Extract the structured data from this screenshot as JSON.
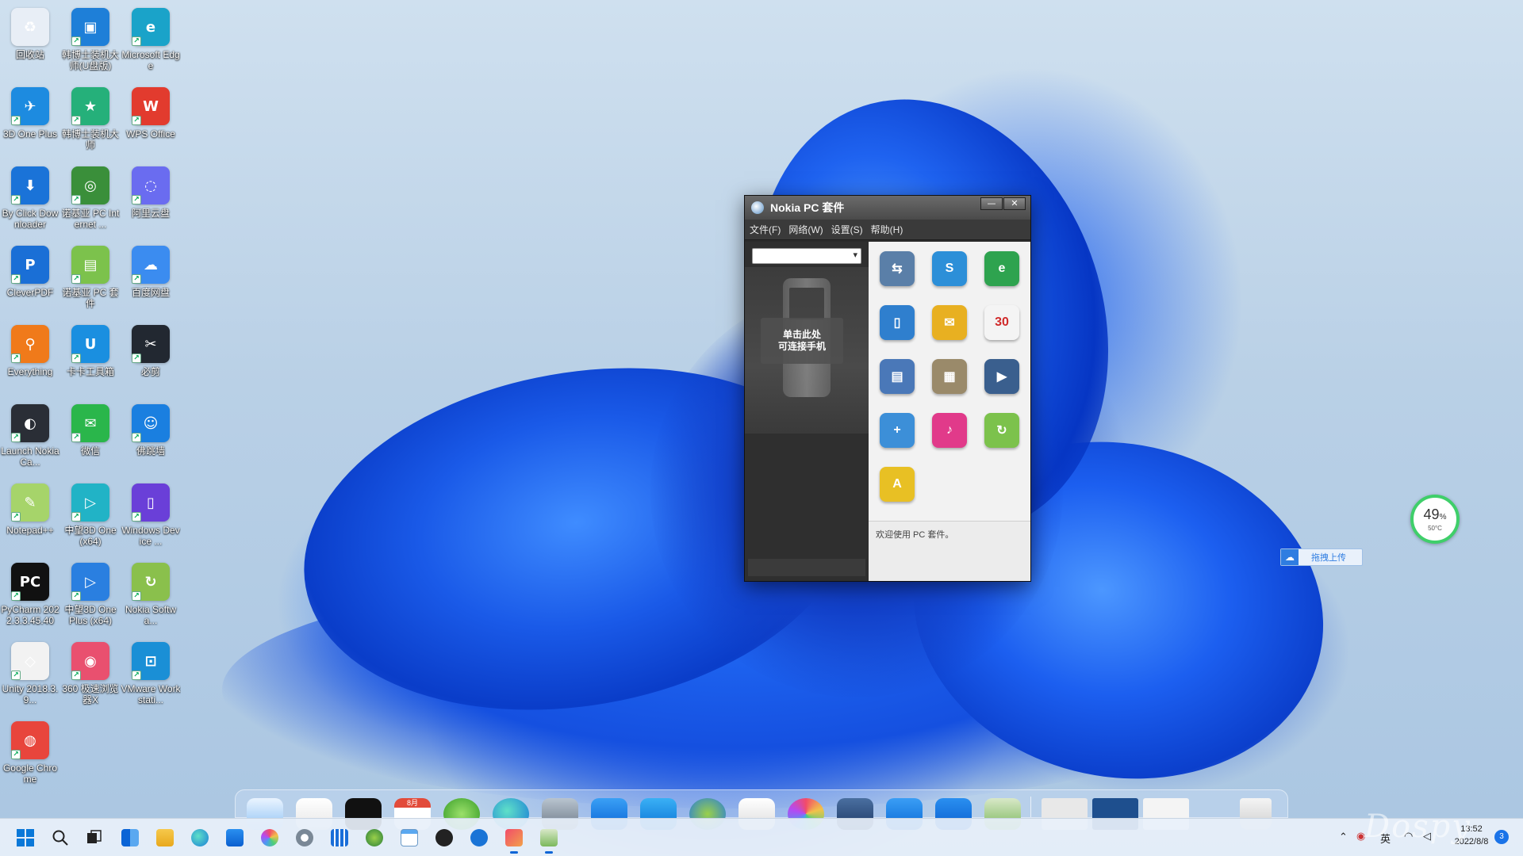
{
  "desktop": {
    "icons": [
      {
        "label": "回收站",
        "icon": "recycle-bin-icon",
        "color": "#e8eef6",
        "glyph": "♻"
      },
      {
        "label": "韩博士装机大师(U盘版)",
        "icon": "usb-installer-icon",
        "color": "#1e7fd8",
        "glyph": "▣"
      },
      {
        "label": "Microsoft Edge",
        "icon": "edge-icon",
        "color": "#1aa3c9",
        "glyph": "e"
      },
      {
        "label": "3D One Plus",
        "icon": "3d-one-plus-icon",
        "color": "#1d8be0",
        "glyph": "✈"
      },
      {
        "label": "韩博士装机大师",
        "icon": "installer-icon",
        "color": "#25b07a",
        "glyph": "★"
      },
      {
        "label": "WPS Office",
        "icon": "wps-office-icon",
        "color": "#e23b2e",
        "glyph": "W"
      },
      {
        "label": "By Click Downloader",
        "icon": "downloader-icon",
        "color": "#1a73d8",
        "glyph": "⬇"
      },
      {
        "label": "诺基亚 PC Internet ...",
        "icon": "globe-icon",
        "color": "#3a8f3a",
        "glyph": "◎"
      },
      {
        "label": "阿里云盘",
        "icon": "aliyun-drive-icon",
        "color": "#6a6cf0",
        "glyph": "◌"
      },
      {
        "label": "CleverPDF",
        "icon": "pdf-icon",
        "color": "#1a6fd6",
        "glyph": "P"
      },
      {
        "label": "诺基亚 PC 套件",
        "icon": "nokia-suite-icon",
        "color": "#7cc24c",
        "glyph": "▤"
      },
      {
        "label": "百度网盘",
        "icon": "baidu-netdisk-icon",
        "color": "#3b8cf0",
        "glyph": "☁"
      },
      {
        "label": "Everything",
        "icon": "search-magnifier-icon",
        "color": "#f07a1a",
        "glyph": "⚲"
      },
      {
        "label": "卡卡工具箱",
        "icon": "toolbox-icon",
        "color": "#1a8fe0",
        "glyph": "U"
      },
      {
        "label": "必剪",
        "icon": "bijian-icon",
        "color": "#222831",
        "glyph": "✂"
      },
      {
        "label": "Launch Nokia Ca...",
        "icon": "nokia-camera-icon",
        "color": "#2a2e36",
        "glyph": "◐"
      },
      {
        "label": "微信",
        "icon": "wechat-icon",
        "color": "#2ab64b",
        "glyph": "✉"
      },
      {
        "label": "佛跳墙",
        "icon": "foxiaoqiang-icon",
        "color": "#1a7fe0",
        "glyph": "☺"
      },
      {
        "label": "Notepad++",
        "icon": "notepad-plus-icon",
        "color": "#a6d46a",
        "glyph": "✎"
      },
      {
        "label": "中望3D One (x64)",
        "icon": "zw3d-one-icon",
        "color": "#21b3c6",
        "glyph": "▷"
      },
      {
        "label": "Windows Device ...",
        "icon": "windows-device-icon",
        "color": "#6a3fd8",
        "glyph": "▯"
      },
      {
        "label": "PyCharm 2022.3.3.45.40",
        "icon": "pycharm-icon",
        "color": "#111111",
        "glyph": "PC"
      },
      {
        "label": "中望3D One Plus (x64)",
        "icon": "zw3d-one-plus-icon",
        "color": "#2a7fe0",
        "glyph": "▷"
      },
      {
        "label": "Nokia Softwa...",
        "icon": "nokia-software-icon",
        "color": "#8ac04c",
        "glyph": "↻"
      },
      {
        "label": "Unity 2018.3.9...",
        "icon": "unity-icon",
        "color": "#f2f2f2",
        "glyph": "◇"
      },
      {
        "label": "360 极速浏览器X",
        "icon": "browser-360-icon",
        "color": "#e9506f",
        "glyph": "◉"
      },
      {
        "label": "VMware Workstati...",
        "icon": "vmware-icon",
        "color": "#1a8fd6",
        "glyph": "⊡"
      },
      {
        "label": "Google Chrome",
        "icon": "chrome-icon",
        "color": "#e8453c",
        "glyph": "◍"
      }
    ]
  },
  "nokia_window": {
    "title": "Nokia PC 套件",
    "minimize_label": "—",
    "close_label": "✕",
    "menu": [
      "文件(F)",
      "网络(W)",
      "设置(S)",
      "帮助(H)"
    ],
    "device_select_value": "",
    "connect_line1": "单击此处",
    "connect_line2": "可连接手机",
    "apps": [
      {
        "name": "backup-app-icon",
        "color": "#5a7fa8",
        "glyph": "⇆"
      },
      {
        "name": "sync-app-icon",
        "color": "#2c8fd8",
        "glyph": "S"
      },
      {
        "name": "connection-app-icon",
        "color": "#2ea34f",
        "glyph": "e"
      },
      {
        "name": "contacts-app-icon",
        "color": "#2f7fce",
        "glyph": "▯"
      },
      {
        "name": "messages-app-icon",
        "color": "#e8b021",
        "glyph": "✉"
      },
      {
        "name": "calendar-app-icon",
        "color": "#f4f4f4",
        "glyph": "30"
      },
      {
        "name": "file-manager-app-icon",
        "color": "#4a78b8",
        "glyph": "▤"
      },
      {
        "name": "image-store-app-icon",
        "color": "#9a8a6a",
        "glyph": "▦"
      },
      {
        "name": "video-app-icon",
        "color": "#3a5f8e",
        "glyph": "▶"
      },
      {
        "name": "install-apps-icon",
        "color": "#3c8fd8",
        "glyph": "+"
      },
      {
        "name": "music-app-icon",
        "color": "#e13a8a",
        "glyph": "♪"
      },
      {
        "name": "nokia-update-app-icon",
        "color": "#7cc24c",
        "glyph": "↻"
      },
      {
        "name": "maps-app-icon",
        "color": "#e8c024",
        "glyph": "A"
      }
    ],
    "status_text": "欢迎使用 PC 套件。"
  },
  "sys_monitor": {
    "percent": "49",
    "percent_sign": "%",
    "temperature": "50°C"
  },
  "upload_pill": {
    "label": "拖拽上传"
  },
  "taskbar": {
    "ime_label": "英",
    "time": "13:52",
    "date": "2022/8/8",
    "notification_count": "3"
  },
  "dock_month": "8月",
  "watermark": "Dospy"
}
